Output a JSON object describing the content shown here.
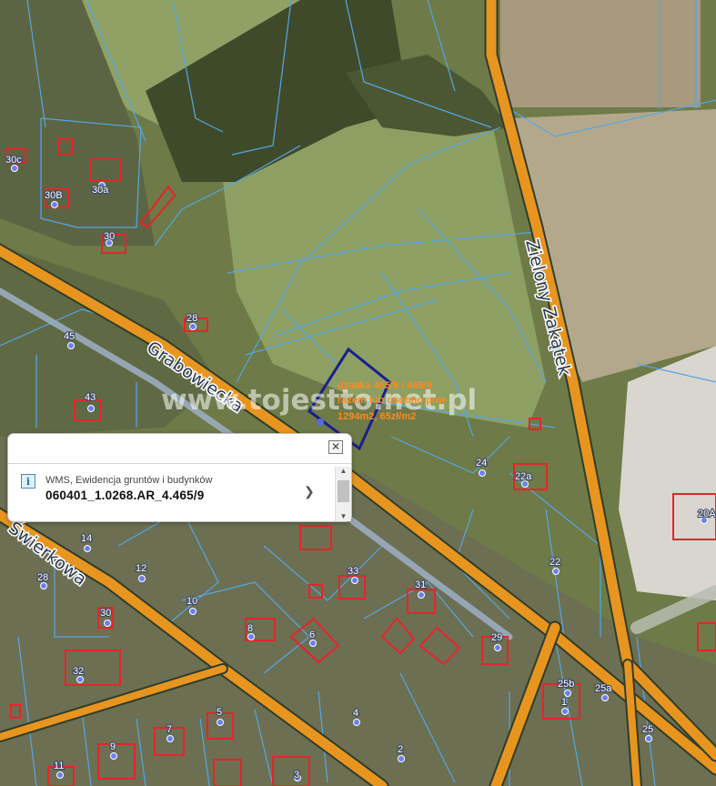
{
  "colors": {
    "road": "#e8951f",
    "parcel_line": "#55a7e6",
    "building": "#e8232a",
    "selection": "#1a1f8c",
    "annotation": "#ff8a1e"
  },
  "roads": {
    "grabowiecka": "Grabowiecka",
    "swierkowa": "Świerkowa",
    "zielony_zakatek": "Zielony Zakątek"
  },
  "address_numbers": [
    "30c",
    "30B",
    "30a",
    "30",
    "28",
    "45",
    "43",
    "24",
    "22a",
    "20A",
    "14",
    "28",
    "12",
    "10",
    "30",
    "33",
    "31",
    "8",
    "6",
    "29",
    "32",
    "22",
    "25b",
    "25a",
    "1",
    "25",
    "5",
    "7",
    "9",
    "11",
    "4",
    "2",
    "3"
  ],
  "watermark": "www.tojestto.net.pl",
  "annotation": {
    "line1": "działka 465/8 i 465/9",
    "line2": "razem lub osobno pow",
    "line3": "1294m2, 65zł/m2"
  },
  "popup": {
    "layer_name": "WMS, Ewidencja gruntów i budynków",
    "identifier": "060401_1.0268.AR_4.465/9",
    "close_icon": "close-icon",
    "info_icon": "info-icon",
    "next_icon": "chevron-right-icon"
  }
}
